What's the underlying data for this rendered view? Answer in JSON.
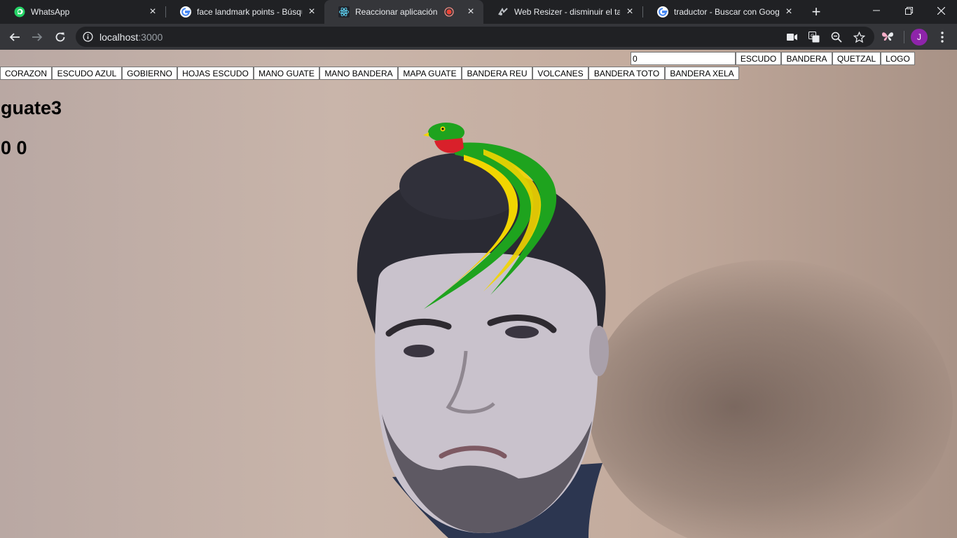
{
  "browser": {
    "tabs": [
      {
        "title": "WhatsApp",
        "icon": "whatsapp-icon"
      },
      {
        "title": "face landmark points - Búsque",
        "icon": "google-icon"
      },
      {
        "title": "Reaccionar aplicación",
        "icon": "react-icon",
        "active": true,
        "recording": true
      },
      {
        "title": "Web Resizer - disminuir el tam",
        "icon": "web-resizer-icon"
      },
      {
        "title": "traductor - Buscar con Google",
        "icon": "google-icon"
      }
    ],
    "address": {
      "host": "localhost",
      "port": ":3000"
    },
    "profile_initial": "J"
  },
  "page": {
    "input_value": "0",
    "top_buttons": [
      "ESCUDO",
      "BANDERA",
      "QUETZAL",
      "LOGO"
    ],
    "filter_buttons": [
      "CORAZON",
      "ESCUDO AZUL",
      "GOBIERNO",
      "HOJAS ESCUDO",
      "MANO GUATE",
      "MANO BANDERA",
      "MAPA GUATE",
      "BANDERA REU",
      "VOLCANES",
      "BANDERA TOTO",
      "BANDERA XELA"
    ],
    "heading": "guate3",
    "coords": "0 0"
  },
  "colors": {
    "quetzal_green": "#1ea31e",
    "quetzal_yellow": "#f2d500",
    "quetzal_red": "#d9202a"
  }
}
